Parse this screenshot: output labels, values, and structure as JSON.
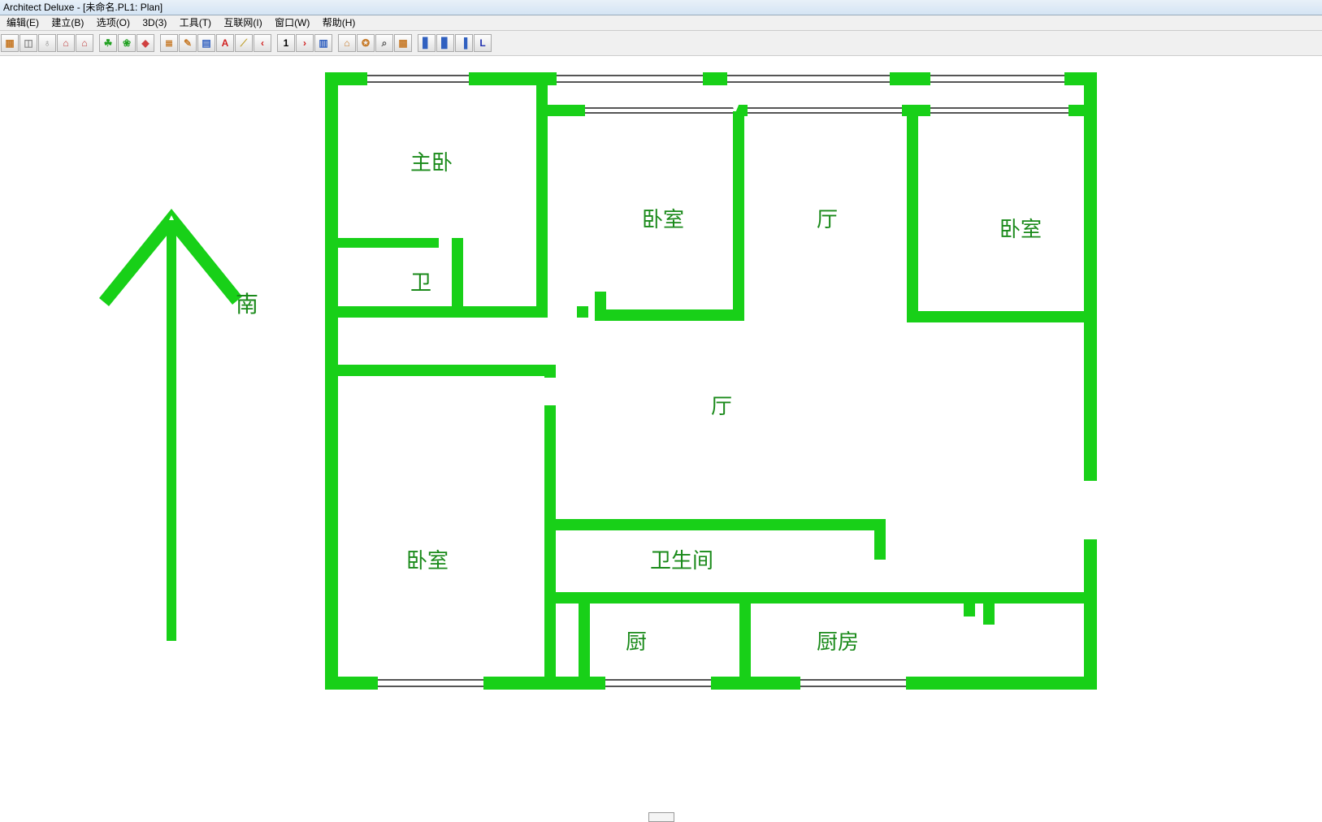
{
  "title": "Architect Deluxe - [未命名.PL1: Plan]",
  "menu": {
    "edit": "编辑(E)",
    "build": "建立(B)",
    "option": "选项(O)",
    "threeD": "3D(3)",
    "tools": "工具(T)",
    "net": "互联网(I)",
    "window": "窗口(W)",
    "help": "帮助(H)"
  },
  "toolbar": {
    "page_number": "1",
    "buttons": [
      {
        "name": "grid-icon",
        "color": "#c77b2a",
        "glyph": "▦"
      },
      {
        "name": "door-icon",
        "color": "#888888",
        "glyph": "◫"
      },
      {
        "name": "lamp-icon",
        "color": "#888888",
        "glyph": "♁"
      },
      {
        "name": "roof-icon",
        "color": "#c04040",
        "glyph": "⌂"
      },
      {
        "name": "house-icon",
        "color": "#c04040",
        "glyph": "⌂"
      },
      {
        "name": "plant-icon",
        "color": "#20a020",
        "glyph": "☘"
      },
      {
        "name": "tree-icon",
        "color": "#20a020",
        "glyph": "❀"
      },
      {
        "name": "color-icon",
        "color": "#d04040",
        "glyph": "◆"
      },
      {
        "name": "books-icon",
        "color": "#c77b2a",
        "glyph": "≣"
      },
      {
        "name": "tools-icon",
        "color": "#c77b2a",
        "glyph": "✎"
      },
      {
        "name": "doc-icon",
        "color": "#3060c0",
        "glyph": "▤"
      },
      {
        "name": "text-icon",
        "color": "#d02020",
        "glyph": "A"
      },
      {
        "name": "ruler-icon",
        "color": "#c0a030",
        "glyph": "⟋"
      },
      {
        "name": "prev-icon",
        "color": "#d02020",
        "glyph": "‹"
      },
      {
        "name": "page-number",
        "color": "#000000",
        "glyph": "1"
      },
      {
        "name": "next-icon",
        "color": "#d02020",
        "glyph": "›"
      },
      {
        "name": "window2-icon",
        "color": "#3060c0",
        "glyph": "▥"
      },
      {
        "name": "chart-icon",
        "color": "#c77b2a",
        "glyph": "⌂"
      },
      {
        "name": "palette-icon",
        "color": "#c77b2a",
        "glyph": "✪"
      },
      {
        "name": "zoom-icon",
        "color": "#555555",
        "glyph": "⌕"
      },
      {
        "name": "calc-icon",
        "color": "#c77b2a",
        "glyph": "▦"
      },
      {
        "name": "view-front-icon",
        "color": "#3060c0",
        "glyph": "▋"
      },
      {
        "name": "view-side-icon",
        "color": "#3060c0",
        "glyph": "▊"
      },
      {
        "name": "view-iso-icon",
        "color": "#3060c0",
        "glyph": "▐"
      },
      {
        "name": "view-l-icon",
        "color": "#2030b0",
        "glyph": "L"
      }
    ],
    "separators_after": [
      4,
      7,
      13,
      16,
      20
    ]
  },
  "compass": {
    "label": "南"
  },
  "rooms": {
    "master_bedroom": "主卧",
    "bathroom_small": "卫",
    "bedroom_top": "卧室",
    "hall_top": "厅",
    "bedroom_right": "卧室",
    "hall_main": "厅",
    "bedroom_left": "卧室",
    "bathroom_big": "卫生间",
    "kitchen_small": "厨",
    "kitchen_big": "厨房"
  },
  "colors": {
    "wall": "#18d018",
    "label": "#1a8a1a"
  }
}
